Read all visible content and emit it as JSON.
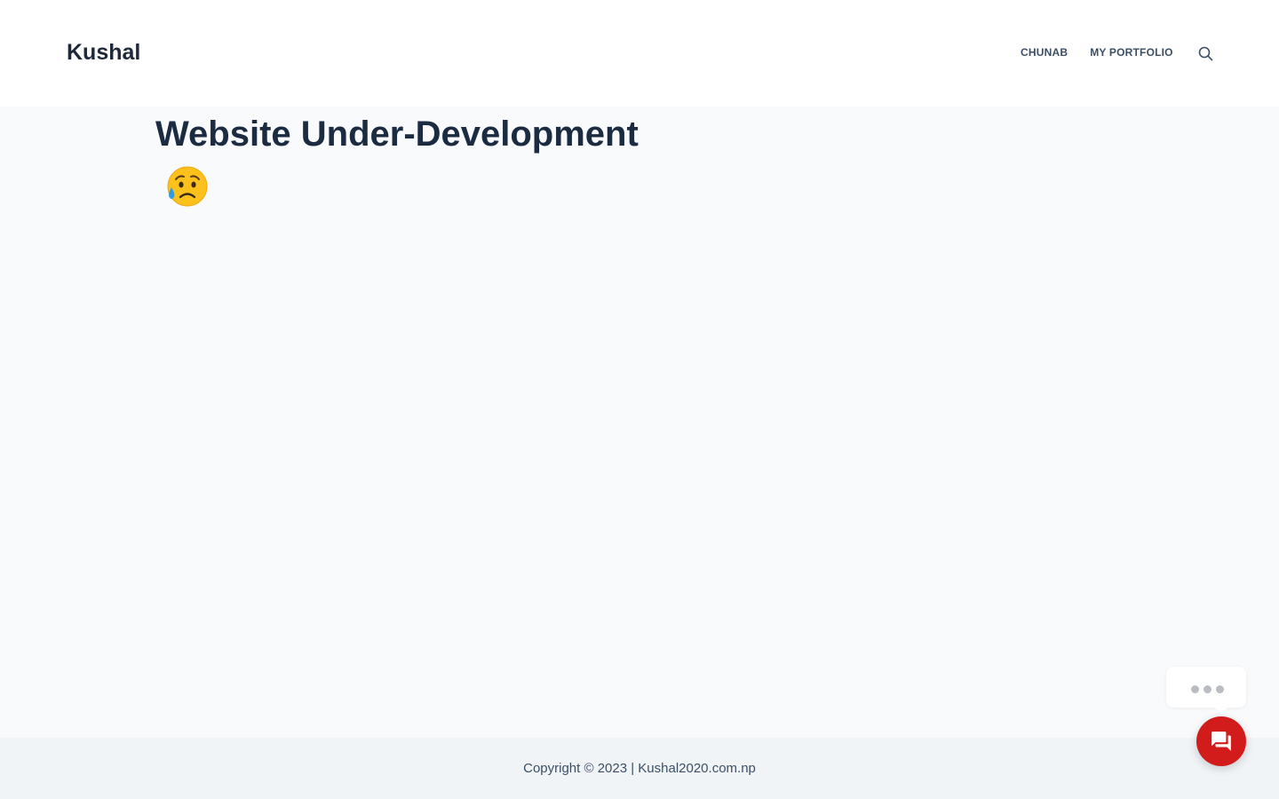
{
  "header": {
    "site_title": "Kushal",
    "nav": [
      {
        "label": "CHUNAB"
      },
      {
        "label": "MY PORTFOLIO"
      }
    ],
    "search_icon": "search-icon"
  },
  "main": {
    "title": "Website Under-Development",
    "emoji_icon": "sad-but-relieved-face-icon"
  },
  "footer": {
    "copyright": "Copyright © 2023 | Kushal2020.com.np"
  },
  "chat_widget": {
    "typing_icon": "typing-dots-icon",
    "button_icon": "chat-icon",
    "button_color": "#d21c1c"
  }
}
